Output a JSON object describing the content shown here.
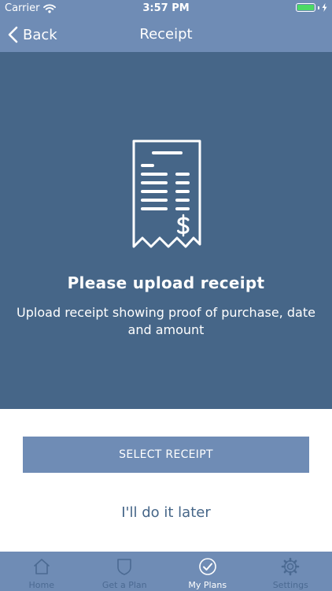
{
  "status_bar": {
    "carrier": "Carrier",
    "time": "3:57 PM"
  },
  "nav": {
    "back_label": "Back",
    "title": "Receipt"
  },
  "hero": {
    "title": "Please upload receipt",
    "description": "Upload receipt showing proof of purchase, date and amount"
  },
  "actions": {
    "select_label": "SELECT RECEIPT",
    "later_label": "I'll do it later"
  },
  "tabs": [
    {
      "label": "Home",
      "icon": "home-icon",
      "active": false
    },
    {
      "label": "Get a Plan",
      "icon": "shield-icon",
      "active": false
    },
    {
      "label": "My Plans",
      "icon": "check-circle-icon",
      "active": true
    },
    {
      "label": "Settings",
      "icon": "gear-icon",
      "active": false
    }
  ],
  "colors": {
    "nav_blue": "#6f8cb5",
    "hero_blue": "#466688",
    "battery_green": "#4cd964",
    "inactive_tab": "#4b6a92"
  }
}
